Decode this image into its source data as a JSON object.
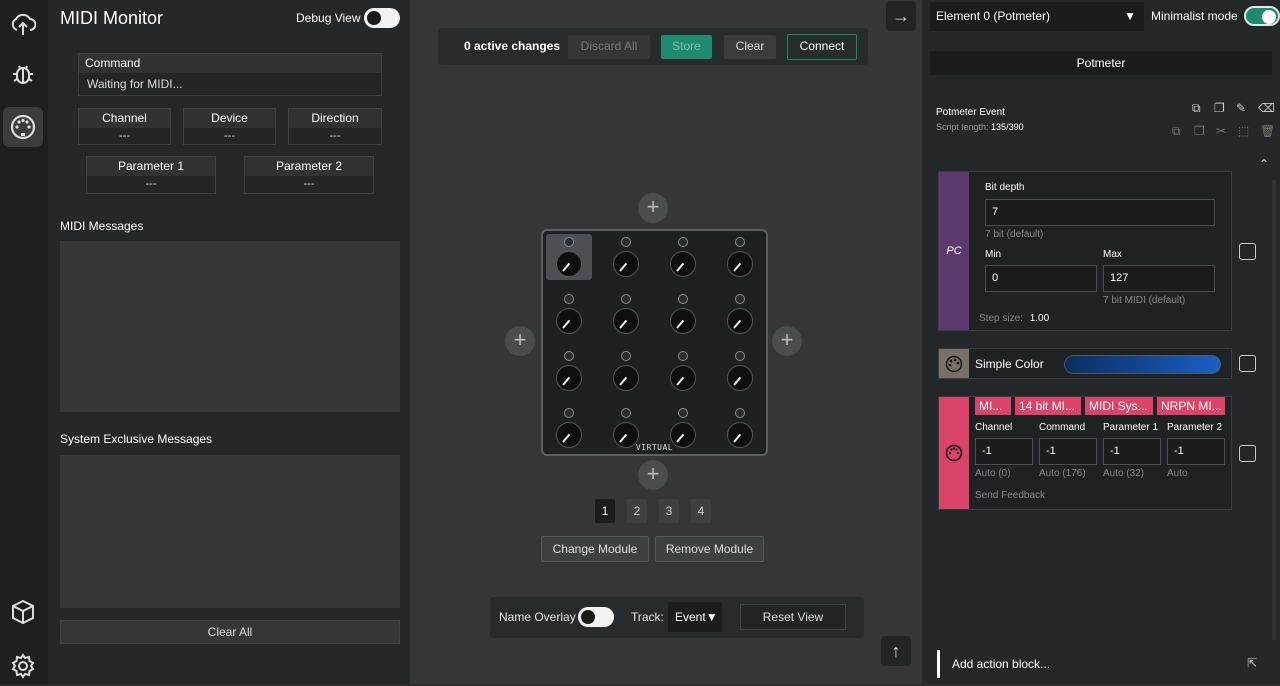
{
  "monitor": {
    "title": "MIDI Monitor",
    "debug_label": "Debug View",
    "command_label": "Command",
    "command_value": "Waiting for MIDI...",
    "channel_label": "Channel",
    "channel_value": "---",
    "device_label": "Device",
    "device_value": "---",
    "direction_label": "Direction",
    "direction_value": "---",
    "param1_label": "Parameter 1",
    "param1_value": "---",
    "param2_label": "Parameter 2",
    "param2_value": "---",
    "midi_messages": "MIDI Messages",
    "sysex_messages": "System Exclusive Messages",
    "clear_all": "Clear All"
  },
  "toolbar": {
    "active_changes": "0 active changes",
    "discard": "Discard All",
    "store": "Store",
    "clear": "Clear",
    "connect": "Connect"
  },
  "module": {
    "label": "VIRTUAL",
    "pages": [
      "1",
      "2",
      "3",
      "4"
    ],
    "change_module": "Change Module",
    "remove_module": "Remove Module"
  },
  "bottom": {
    "name_overlay": "Name Overlay",
    "track_label": "Track:",
    "track_value": "Event",
    "reset_view": "Reset View"
  },
  "right": {
    "element_select": "Element 0 (Potmeter)",
    "minimalist": "Minimalist mode",
    "panel_title": "Potmeter",
    "event_title": "Potmeter Event",
    "script_length_label": "Script length:",
    "script_length_value": "135/390",
    "pc": {
      "tag": "PC",
      "bit_depth_label": "Bit depth",
      "bit_depth_value": "7",
      "bit_depth_hint": "7 bit (default)",
      "min_label": "Min",
      "min_value": "0",
      "max_label": "Max",
      "max_value": "127",
      "max_hint": "7 bit MIDI (default)",
      "step_label": "Step size:",
      "step_value": "1.00"
    },
    "simple_color": "Simple Color",
    "midi": {
      "tabs": [
        "MI...",
        "14 bit MI...",
        "MIDI Sys...",
        "NRPN MI..."
      ],
      "channel_label": "Channel",
      "channel_value": "-1",
      "channel_hint": "Auto (0)",
      "command_label": "Command",
      "command_value": "-1",
      "command_hint": "Auto (176)",
      "p1_label": "Parameter 1",
      "p1_value": "-1",
      "p1_hint": "Auto (32)",
      "p2_label": "Parameter 2",
      "p2_value": "-1",
      "p2_hint": "Auto",
      "send_feedback": "Send Feedback"
    },
    "add_action": "Add action block...",
    "colors": {
      "pc": "#5c3a6e",
      "midi": "#d94468",
      "accent": "#1f8a70"
    }
  }
}
